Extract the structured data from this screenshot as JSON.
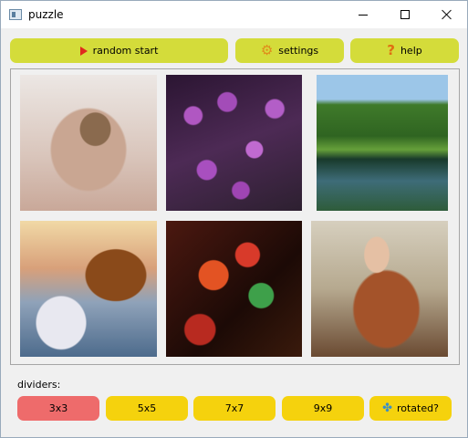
{
  "window": {
    "title": "puzzle"
  },
  "toolbar": {
    "random_start": "random start",
    "settings": "settings",
    "help": "help"
  },
  "icons": {
    "random_start": "play-icon",
    "settings": "gear-icon",
    "help": "question-icon",
    "rotated": "puzzle-piece-icon"
  },
  "dividers": {
    "label": "dividers:",
    "options": [
      "3x3",
      "5x5",
      "7x7",
      "9x9"
    ],
    "selected": "3x3",
    "rotated_label": "rotated?"
  },
  "colors": {
    "top_button": "#d4dc3a",
    "divider_button": "#f5d20d",
    "divider_selected": "#ee6b6b"
  }
}
